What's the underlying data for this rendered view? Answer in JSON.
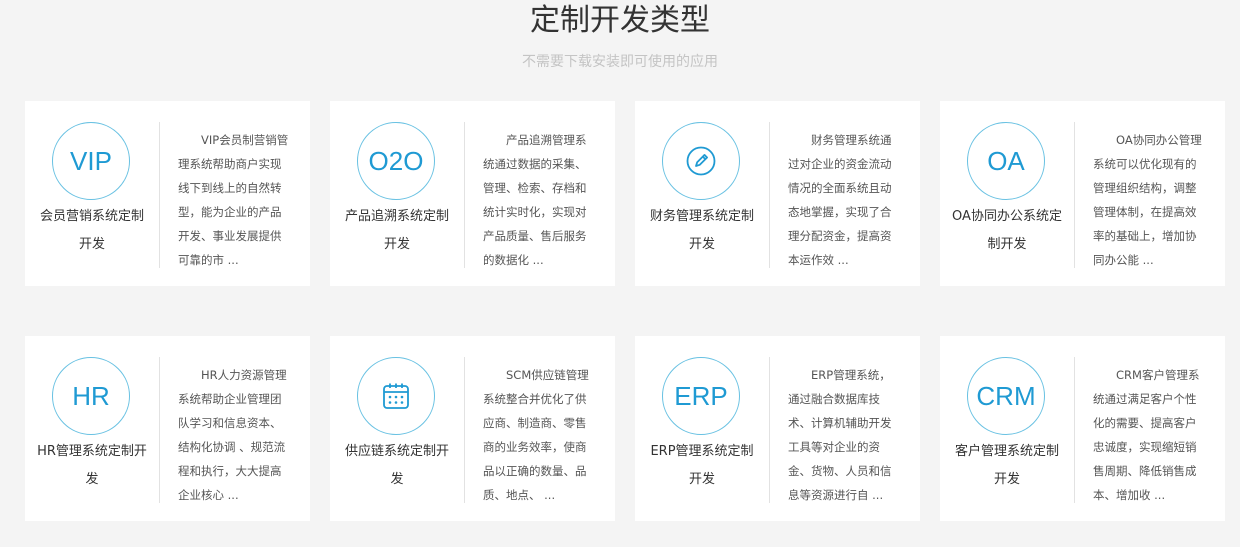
{
  "page": {
    "title": "定制开发类型",
    "subtitle": "不需要下载安装即可使用的应用"
  },
  "colors": {
    "accent": "#1f9ad3",
    "ring": "#68c1e2",
    "background": "#f4f4f4"
  },
  "cards": [
    {
      "icon_text": "VIP",
      "name": "会员营销系统定制开发",
      "desc": "VIP会员制营销管理系统帮助商户实现线下到线上的自然转型，能为企业的产品开发、事业发展提供可靠的市 ..."
    },
    {
      "icon_text": "O2O",
      "name": "产品追溯系统定制开发",
      "desc": "产品追溯管理系统通过数据的采集、管理、检索、存档和统计实时化，实现对产品质量、售后服务的数据化 ..."
    },
    {
      "icon_text": "",
      "icon_name": "pen-icon",
      "name": "财务管理系统定制开发",
      "desc": "财务管理系统通过对企业的资金流动情况的全面系统且动态地掌握，实现了合理分配资金，提高资本运作效 ..."
    },
    {
      "icon_text": "OA",
      "name": "OA协同办公系统定制开发",
      "desc": "OA协同办公管理系统可以优化现有的管理组织结构，调整管理体制，在提高效率的基础上，增加协同办公能 ..."
    },
    {
      "icon_text": "HR",
      "name": "HR管理系统定制开发",
      "desc": "HR人力资源管理系统帮助企业管理团队学习和信息资本、结构化协调 、规范流程和执行，大大提高企业核心 ..."
    },
    {
      "icon_text": "",
      "icon_name": "calendar-icon",
      "name": "供应链系统定制开发",
      "desc": "SCM供应链管理系统整合并优化了供应商、制造商、零售商的业务效率，使商品以正确的数量、品质、地点、 ..."
    },
    {
      "icon_text": "ERP",
      "name": "ERP管理系统定制开发",
      "desc": "ERP管理系统，通过融合数据库技术、计算机辅助开发工具等对企业的资金、货物、人员和信息等资源进行自 ..."
    },
    {
      "icon_text": "CRM",
      "name": "客户管理系统定制开发",
      "desc": "CRM客户管理系统通过满足客户个性化的需要、提高客户忠诚度，实现缩短销售周期、降低销售成本、增加收 ..."
    }
  ]
}
